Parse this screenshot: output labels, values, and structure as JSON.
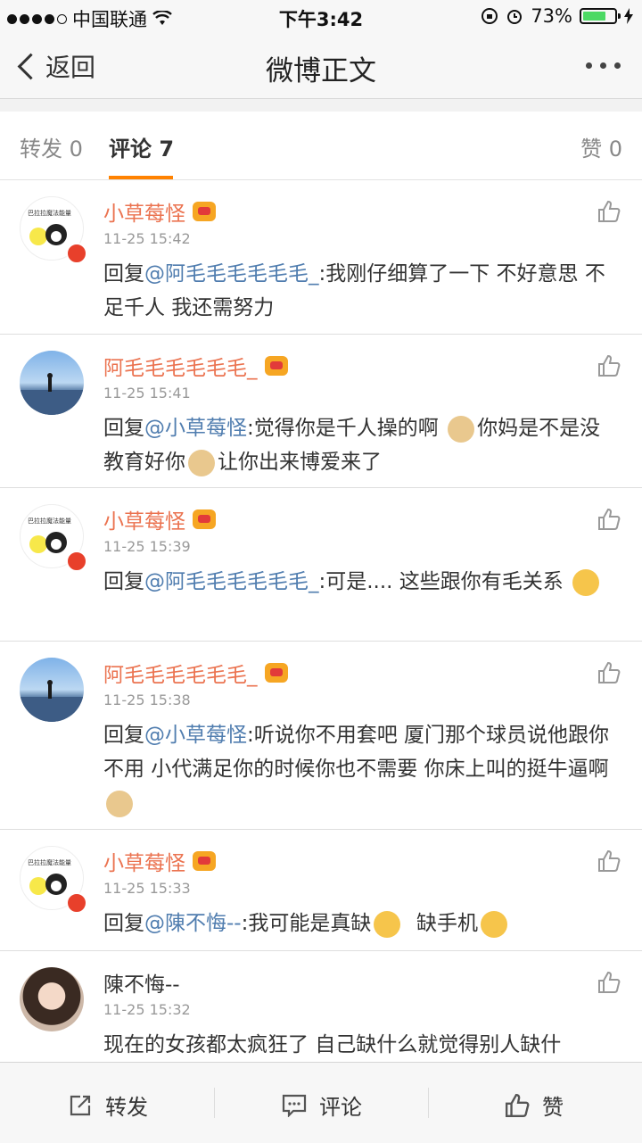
{
  "status_bar": {
    "carrier": "中国联通",
    "time": "下午3:42",
    "battery": "73%",
    "battery_level": 0.73
  },
  "nav": {
    "back_label": "返回",
    "title": "微博正文"
  },
  "tabs": {
    "repost": "转发 0",
    "comment": "评论 7",
    "like": "赞 0"
  },
  "comments": [
    {
      "name": "小草莓怪",
      "time": "11-25 15:42",
      "reply": "回复",
      "mention": "@阿毛毛毛毛毛毛_",
      "text": ":我刚仔细算了一下 不好意思 不足千人 我还需努力"
    },
    {
      "name": "阿毛毛毛毛毛毛_",
      "time": "11-25 15:41",
      "reply": "回复",
      "mention": "@小草莓怪",
      "text1": ":觉得你是千人操的啊",
      "text2": "你妈是不是没教育好你",
      "text3": "让你出来博爱来了"
    },
    {
      "name": "小草莓怪",
      "time": "11-25 15:39",
      "reply": "回复",
      "mention": "@阿毛毛毛毛毛毛_",
      "text": ":可是.... 这些跟你有毛关系"
    },
    {
      "name": "阿毛毛毛毛毛毛_",
      "time": "11-25 15:38",
      "reply": "回复",
      "mention": "@小草莓怪",
      "text": ":听说你不用套吧 厦门那个球员说他跟你不用  小代满足你的时候你也不需要 你床上叫的挺牛逼啊"
    },
    {
      "name": "小草莓怪",
      "time": "11-25 15:33",
      "reply": "回复",
      "mention": "@陳不悔--",
      "text1": ":我可能是真缺",
      "text2": "缺手机"
    },
    {
      "name": "陳不悔--",
      "time": "11-25 15:32",
      "text": "现在的女孩都太疯狂了 自己缺什么就觉得别人缺什"
    }
  ],
  "bottom_bar": {
    "repost": "转发",
    "comment": "评论",
    "like": "赞"
  }
}
